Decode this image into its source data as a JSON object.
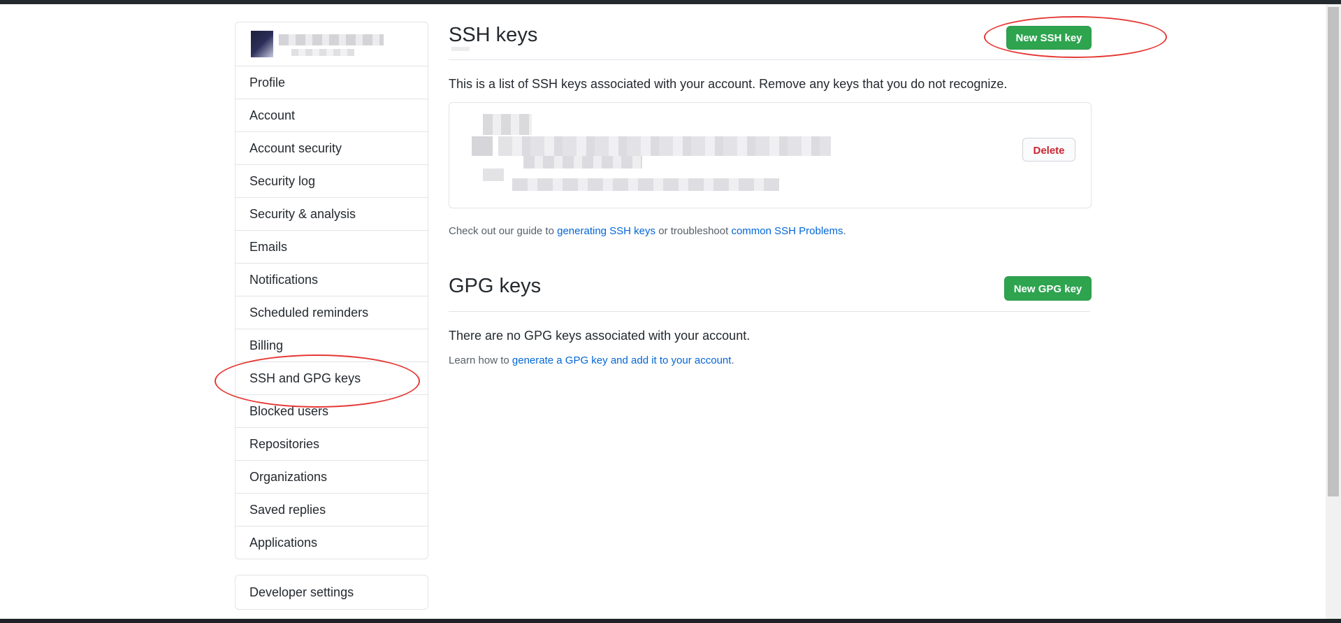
{
  "sidebar": {
    "items": [
      {
        "label": "Profile"
      },
      {
        "label": "Account"
      },
      {
        "label": "Account security"
      },
      {
        "label": "Security log"
      },
      {
        "label": "Security & analysis"
      },
      {
        "label": "Emails"
      },
      {
        "label": "Notifications"
      },
      {
        "label": "Scheduled reminders"
      },
      {
        "label": "Billing"
      },
      {
        "label": "SSH and GPG keys"
      },
      {
        "label": "Blocked users"
      },
      {
        "label": "Repositories"
      },
      {
        "label": "Organizations"
      },
      {
        "label": "Saved replies"
      },
      {
        "label": "Applications"
      }
    ],
    "developer_settings": "Developer settings"
  },
  "ssh": {
    "title": "SSH keys",
    "new_button": "New SSH key",
    "description": "This is a list of SSH keys associated with your account. Remove any keys that you do not recognize.",
    "delete_button": "Delete",
    "guide_prefix": "Check out our guide to ",
    "guide_link": "generating SSH keys",
    "guide_middle": " or troubleshoot ",
    "problems_link": "common SSH Problems",
    "guide_suffix": "."
  },
  "gpg": {
    "title": "GPG keys",
    "new_button": "New GPG key",
    "empty_text": "There are no GPG keys associated with your account.",
    "learn_prefix": "Learn how to ",
    "learn_link": "generate a GPG key and add it to your account",
    "learn_suffix": "."
  },
  "colors": {
    "primary_button": "#2ea44f",
    "link": "#0366d6",
    "danger": "#cb2431",
    "annotation": "#e53935"
  }
}
